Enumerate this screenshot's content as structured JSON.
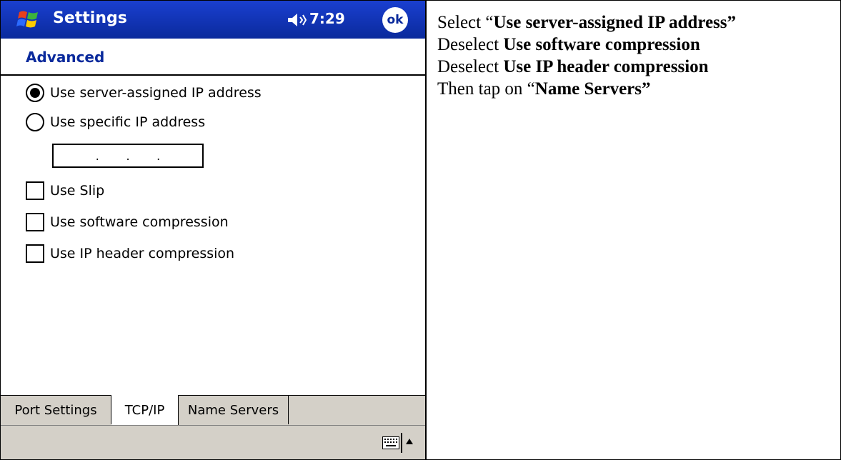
{
  "device": {
    "title": "Settings",
    "time": "7:29",
    "ok_label": "ok",
    "header": "Advanced",
    "options": [
      {
        "label": "Use server-assigned IP address",
        "type": "radio",
        "selected": true
      },
      {
        "label": "Use specific IP address",
        "type": "radio",
        "selected": false
      }
    ],
    "ip_field": {
      "dots": [
        ".",
        ".",
        "."
      ]
    },
    "checkboxes": [
      {
        "label": "Use Slip",
        "checked": false
      },
      {
        "label": "Use software compression",
        "checked": false
      },
      {
        "label": "Use IP header compression",
        "checked": false
      }
    ],
    "tabs": [
      {
        "label": "Port Settings",
        "active": false
      },
      {
        "label": "TCP/IP",
        "active": true
      },
      {
        "label": "Name Servers",
        "active": false
      }
    ],
    "icons": {
      "start": "windows-start-icon",
      "speaker": "speaker-icon",
      "keyboard": "keyboard-icon",
      "arrow": "arrow-up-icon"
    },
    "colors": {
      "titlebar": "#0a2a9c",
      "header_text": "#0a2a9c",
      "bars": "#d4d0c8"
    }
  },
  "instructions": {
    "line1": {
      "pre": "Select “",
      "bold": "Use server-assigned IP address”"
    },
    "line2": {
      "pre": "Deselect ",
      "bold": "Use software compression"
    },
    "line3": {
      "pre": "Deselect ",
      "bold": "Use IP header compression"
    },
    "line4": {
      "pre": "Then tap on “",
      "bold": "Name Servers”"
    }
  }
}
